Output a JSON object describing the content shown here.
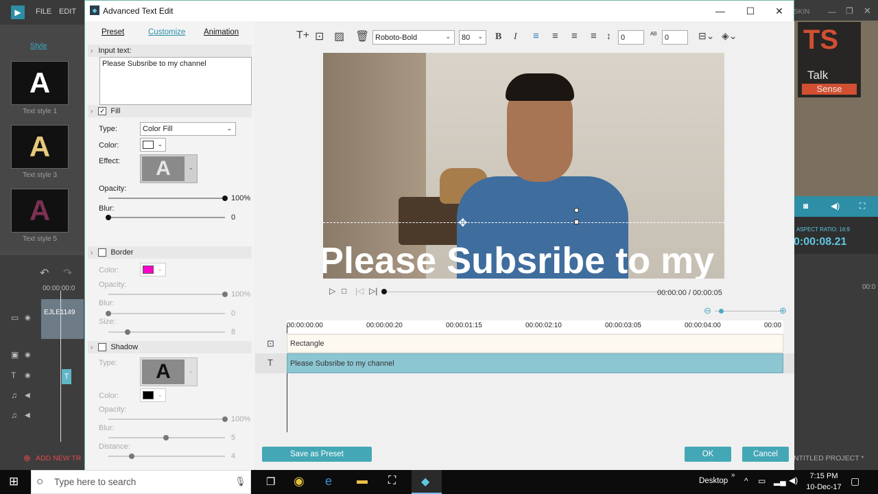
{
  "bg": {
    "menu": [
      "FILE",
      "EDIT"
    ],
    "style_tab": "Style",
    "tiles": [
      {
        "letter": "A",
        "caption": "Text style 1",
        "color": "#ffffff"
      },
      {
        "letter": "A",
        "caption": "Text style 3",
        "color": "#e8c97a"
      },
      {
        "letter": "A",
        "caption": "Text style 5",
        "color": "#6b2a4a"
      }
    ],
    "timecode_start": "00:00:00:0",
    "clip_label": "EJLE1149",
    "add_track": "ADD NEW TR",
    "right_skin": "SKIN",
    "brand_line1": "Talk",
    "brand_line2": "Sense",
    "aspect_ratio": "ASPECT RATIO: 16:9",
    "timecode": "0:00:08.21",
    "right_tick": "00:0",
    "project": "NTITLED PROJECT *"
  },
  "dialog": {
    "title": "Advanced Text Edit",
    "tabs": [
      "Preset",
      "Customize",
      "Animation"
    ],
    "input_label": "Input text:",
    "input_text": "Please Subsribe to my channel",
    "fill": {
      "label": "Fill",
      "type_label": "Type:",
      "type_value": "Color Fill",
      "color_label": "Color:",
      "color": "#ffffff",
      "effect_label": "Effect:",
      "effect_letter": "A",
      "opacity_label": "Opacity:",
      "opacity_value": "100%",
      "opacity_level": 1.0,
      "blur_label": "Blur:",
      "blur_value": "0",
      "blur_level": 0
    },
    "border": {
      "label": "Border",
      "color_label": "Color:",
      "color": "#ff00cc",
      "opacity_label": "Opacity:",
      "opacity_value": "100%",
      "blur_label": "Blur:",
      "blur_value": "0",
      "size_label": "Size:",
      "size_value": "8"
    },
    "shadow": {
      "label": "Shadow",
      "type_label": "Type:",
      "type_letter": "A",
      "color_label": "Color:",
      "color": "#000000",
      "opacity_label": "Opacity:",
      "opacity_value": "100%",
      "blur_label": "Blur:",
      "blur_value": "5",
      "distance_label": "Distance:",
      "distance_value": "4"
    },
    "toolbar": {
      "font": "Roboto-Bold",
      "size": "80",
      "spacing1": "0",
      "spacing2": "0",
      "bold": "B",
      "italic": "I"
    },
    "preview_text": "Please Subsribe to my ch",
    "playback_time": "00:00:00 / 00:00:05",
    "ruler": [
      "00:00:00:00",
      "00:00:00:20",
      "00:00:01:15",
      "00:00:02:10",
      "00:00:03:05",
      "00:00:04:00",
      "00:00"
    ],
    "tracks": [
      {
        "icon": "rectangle-icon",
        "label": "Rectangle"
      },
      {
        "icon": "text-icon",
        "label": "Please Subsribe to my channel"
      }
    ],
    "save_preset": "Save as Preset",
    "ok": "OK",
    "cancel": "Cancel"
  },
  "taskbar": {
    "search_placeholder": "Type here to search",
    "desktop": "Desktop",
    "time": "7:15 PM",
    "date": "10-Dec-17"
  }
}
